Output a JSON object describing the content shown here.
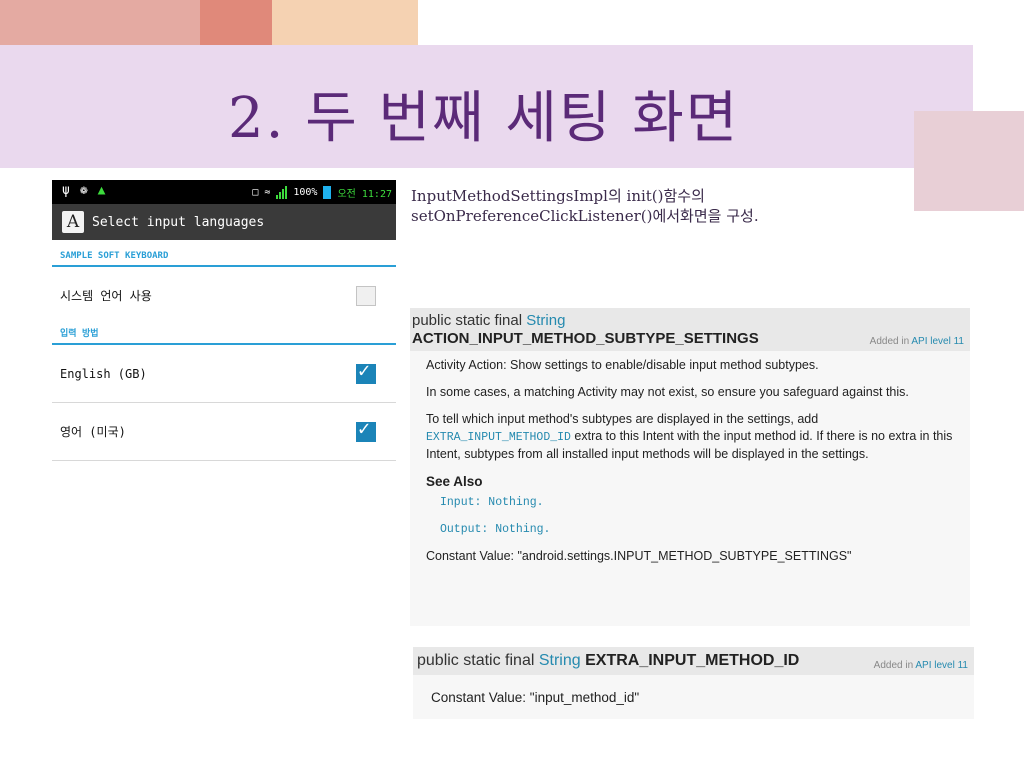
{
  "slide": {
    "title": "2. 두 번째 세팅 화면",
    "description_line1": "InputMethodSettingsImpl의 init()함수의",
    "description_line2": "setOnPreferenceClickListener()에서화면을 구성."
  },
  "phone": {
    "statusbar": {
      "battery_percent": "100%",
      "time": "오전 11:27"
    },
    "appbar": {
      "icon_letter": "A",
      "title": "Select input languages"
    },
    "section1_header": "SAMPLE SOFT KEYBOARD",
    "system_language_row": {
      "label": "시스템 언어 사용",
      "checked": false
    },
    "section2_header": "입력 방법",
    "languages": [
      {
        "label": "English (GB)",
        "checked": true
      },
      {
        "label": "영어 (미국)",
        "checked": true
      }
    ]
  },
  "api_doc_1": {
    "modifiers": "public static final",
    "type": "String",
    "constant": "ACTION_INPUT_METHOD_SUBTYPE_SETTINGS",
    "added_prefix": "Added in",
    "api_level": "API level 11",
    "para1": "Activity Action: Show settings to enable/disable input method subtypes.",
    "para2": "In some cases, a matching Activity may not exist, so ensure you safeguard against this.",
    "para3_before": "To tell which input method's subtypes are displayed in the settings, add",
    "para3_code": "EXTRA_INPUT_METHOD_ID",
    "para3_after": "extra to this Intent with the input method id. If there is no extra in this Intent, subtypes from all installed input methods will be displayed in the settings.",
    "see_also": "See Also",
    "input_note": "Input: Nothing.",
    "output_note": "Output: Nothing.",
    "constant_value": "Constant Value: \"android.settings.INPUT_METHOD_SUBTYPE_SETTINGS\""
  },
  "api_doc_2": {
    "modifiers": "public static final",
    "type": "String",
    "constant": "EXTRA_INPUT_METHOD_ID",
    "added_prefix": "Added in",
    "api_level": "API level 11",
    "constant_value": "Constant Value: \"input_method_id\""
  },
  "colors": {
    "title": "#5b2a78",
    "title_band": "#ead9ee",
    "android_accent": "#2a9fd6",
    "doc_link": "#258aaf"
  }
}
